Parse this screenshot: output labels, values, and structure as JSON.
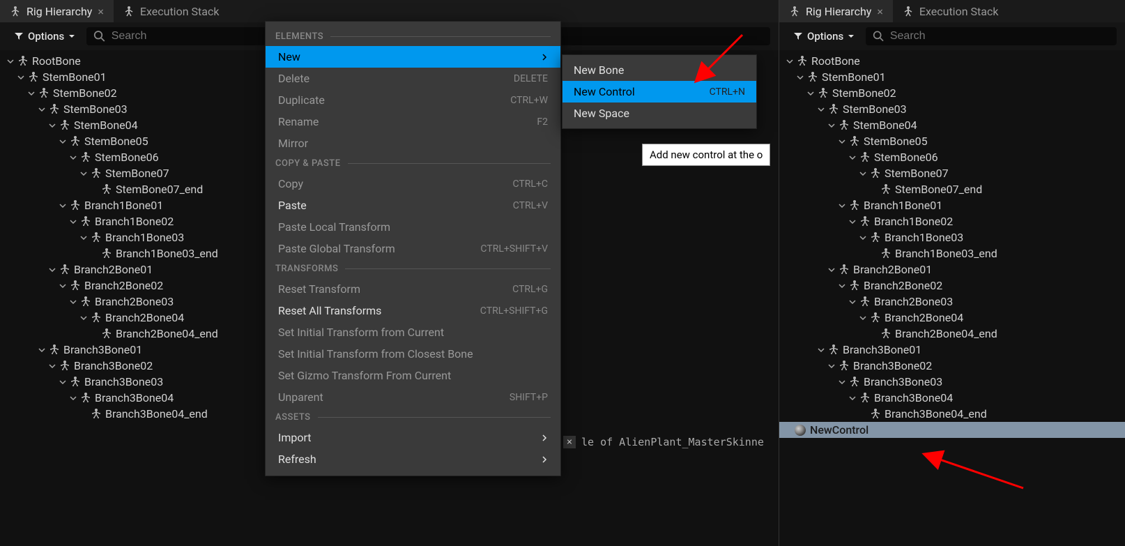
{
  "left": {
    "tabs": [
      {
        "label": "Rig Hierarchy",
        "active": true
      },
      {
        "label": "Execution Stack",
        "active": false
      }
    ],
    "options_label": "Options",
    "search_placeholder": "Search",
    "tree": [
      {
        "name": "RootBone",
        "depth": 0,
        "arrow": true
      },
      {
        "name": "StemBone01",
        "depth": 1,
        "arrow": true
      },
      {
        "name": "StemBone02",
        "depth": 2,
        "arrow": true
      },
      {
        "name": "StemBone03",
        "depth": 3,
        "arrow": true
      },
      {
        "name": "StemBone04",
        "depth": 4,
        "arrow": true
      },
      {
        "name": "StemBone05",
        "depth": 5,
        "arrow": true
      },
      {
        "name": "StemBone06",
        "depth": 6,
        "arrow": true
      },
      {
        "name": "StemBone07",
        "depth": 7,
        "arrow": true
      },
      {
        "name": "StemBone07_end",
        "depth": 8,
        "arrow": false
      },
      {
        "name": "Branch1Bone01",
        "depth": 5,
        "arrow": true
      },
      {
        "name": "Branch1Bone02",
        "depth": 6,
        "arrow": true
      },
      {
        "name": "Branch1Bone03",
        "depth": 7,
        "arrow": true
      },
      {
        "name": "Branch1Bone03_end",
        "depth": 8,
        "arrow": false
      },
      {
        "name": "Branch2Bone01",
        "depth": 4,
        "arrow": true
      },
      {
        "name": "Branch2Bone02",
        "depth": 5,
        "arrow": true
      },
      {
        "name": "Branch2Bone03",
        "depth": 6,
        "arrow": true
      },
      {
        "name": "Branch2Bone04",
        "depth": 7,
        "arrow": true
      },
      {
        "name": "Branch2Bone04_end",
        "depth": 8,
        "arrow": false
      },
      {
        "name": "Branch3Bone01",
        "depth": 3,
        "arrow": true
      },
      {
        "name": "Branch3Bone02",
        "depth": 4,
        "arrow": true
      },
      {
        "name": "Branch3Bone03",
        "depth": 5,
        "arrow": true
      },
      {
        "name": "Branch3Bone04",
        "depth": 6,
        "arrow": true
      },
      {
        "name": "Branch3Bone04_end",
        "depth": 7,
        "arrow": false
      }
    ]
  },
  "context_menu": {
    "sections": {
      "elements": "ELEMENTS",
      "copy_paste": "COPY & PASTE",
      "transforms": "TRANSFORMS",
      "assets": "ASSETS"
    },
    "items": {
      "new": "New",
      "delete": "Delete",
      "duplicate": "Duplicate",
      "rename": "Rename",
      "mirror": "Mirror",
      "copy": "Copy",
      "paste": "Paste",
      "paste_local": "Paste Local Transform",
      "paste_global": "Paste Global Transform",
      "reset_transform": "Reset Transform",
      "reset_all": "Reset All Transforms",
      "set_initial_current": "Set Initial Transform from Current",
      "set_initial_closest": "Set Initial Transform from Closest Bone",
      "set_gizmo": "Set Gizmo Transform From Current",
      "unparent": "Unparent",
      "import": "Import",
      "refresh": "Refresh"
    },
    "shortcuts": {
      "delete": "DELETE",
      "duplicate": "CTRL+W",
      "rename": "F2",
      "copy": "CTRL+C",
      "paste": "CTRL+V",
      "paste_global": "CTRL+SHIFT+V",
      "reset_transform": "CTRL+G",
      "reset_all": "CTRL+SHIFT+G",
      "unparent": "SHIFT+P"
    }
  },
  "submenu": {
    "new_bone": "New Bone",
    "new_control": "New Control",
    "new_space": "New Space",
    "new_control_shortcut": "CTRL+N"
  },
  "tooltip": "Add new control at the o",
  "status_text": "le of AlienPlant_MasterSkinne",
  "right": {
    "tabs": [
      {
        "label": "Rig Hierarchy",
        "active": true
      },
      {
        "label": "Execution Stack",
        "active": false
      }
    ],
    "options_label": "Options",
    "search_placeholder": "Search",
    "tree": [
      {
        "name": "RootBone",
        "depth": 0,
        "arrow": true
      },
      {
        "name": "StemBone01",
        "depth": 1,
        "arrow": true
      },
      {
        "name": "StemBone02",
        "depth": 2,
        "arrow": true
      },
      {
        "name": "StemBone03",
        "depth": 3,
        "arrow": true
      },
      {
        "name": "StemBone04",
        "depth": 4,
        "arrow": true
      },
      {
        "name": "StemBone05",
        "depth": 5,
        "arrow": true
      },
      {
        "name": "StemBone06",
        "depth": 6,
        "arrow": true
      },
      {
        "name": "StemBone07",
        "depth": 7,
        "arrow": true
      },
      {
        "name": "StemBone07_end",
        "depth": 8,
        "arrow": false
      },
      {
        "name": "Branch1Bone01",
        "depth": 5,
        "arrow": true
      },
      {
        "name": "Branch1Bone02",
        "depth": 6,
        "arrow": true
      },
      {
        "name": "Branch1Bone03",
        "depth": 7,
        "arrow": true
      },
      {
        "name": "Branch1Bone03_end",
        "depth": 8,
        "arrow": false
      },
      {
        "name": "Branch2Bone01",
        "depth": 4,
        "arrow": true
      },
      {
        "name": "Branch2Bone02",
        "depth": 5,
        "arrow": true
      },
      {
        "name": "Branch2Bone03",
        "depth": 6,
        "arrow": true
      },
      {
        "name": "Branch2Bone04",
        "depth": 7,
        "arrow": true
      },
      {
        "name": "Branch2Bone04_end",
        "depth": 8,
        "arrow": false
      },
      {
        "name": "Branch3Bone01",
        "depth": 3,
        "arrow": true
      },
      {
        "name": "Branch3Bone02",
        "depth": 4,
        "arrow": true
      },
      {
        "name": "Branch3Bone03",
        "depth": 5,
        "arrow": true
      },
      {
        "name": "Branch3Bone04",
        "depth": 6,
        "arrow": true
      },
      {
        "name": "Branch3Bone04_end",
        "depth": 7,
        "arrow": false
      }
    ],
    "new_control_label": "NewControl"
  }
}
